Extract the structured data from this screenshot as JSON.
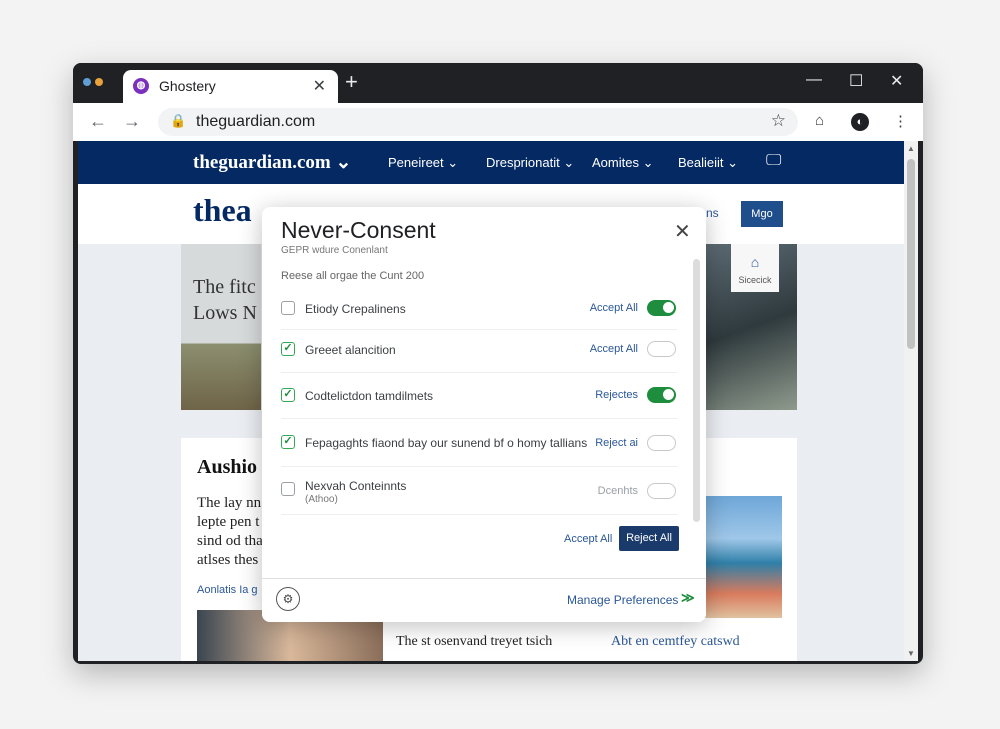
{
  "browser": {
    "tab_title": "Ghostery",
    "tab_icon": "ghostery-icon",
    "new_tab": "+",
    "url": "theguardian.com",
    "window_controls": {
      "minimize": "—",
      "maximize": "☐",
      "close": "✕"
    }
  },
  "site": {
    "nav_logo": "theguardian.com",
    "nav_items": [
      "Peneireet",
      "Dresprionatit",
      "Aomites",
      "Bealieiit"
    ],
    "header_logo": "thea",
    "header_tail": "ns",
    "header_button": "Mgo",
    "article1_text": "The fitc\nLows N",
    "sidecard_label": "Sicecick",
    "lower_heading": "Aushio",
    "lower_body": "The lay nn\nlepte pen t\nsind od tha\natlses thes",
    "lower_byline": "Aonlatis Ia g",
    "caption1": "The st osenvand treyet tsich",
    "caption2": "Abt en cemtfey catswd"
  },
  "modal": {
    "title": "Never-Consent",
    "subtitle": "GEPR wdure Conenlant",
    "description": "Reese all orgae the Cunt 200",
    "rows": [
      {
        "label": "Etiody Crepalinens",
        "sublabel": "",
        "checked": false,
        "action": "Accept All",
        "toggle": "on"
      },
      {
        "label": "Greeet alancition",
        "sublabel": "",
        "checked": true,
        "action": "Accept All",
        "toggle": "off"
      },
      {
        "label": "Codtelictdon tamdilmets",
        "sublabel": "",
        "checked": true,
        "action": "Rejectes",
        "toggle": "on"
      },
      {
        "label": "Fepagaghts fiaond bay our sunend bf o homy tallians",
        "sublabel": "",
        "checked": true,
        "action": "Reject ai",
        "toggle": "off"
      },
      {
        "label": "Nexvah Conteinnts",
        "sublabel": "(Athoo)",
        "checked": false,
        "action": "Dcenhts",
        "toggle": "off"
      }
    ],
    "accept_all": "Accept All",
    "reject_all": "Reject All",
    "manage_preferences": "Manage Preferences",
    "colors": {
      "accent_green": "#1e8e3e",
      "navy": "#052962"
    }
  }
}
